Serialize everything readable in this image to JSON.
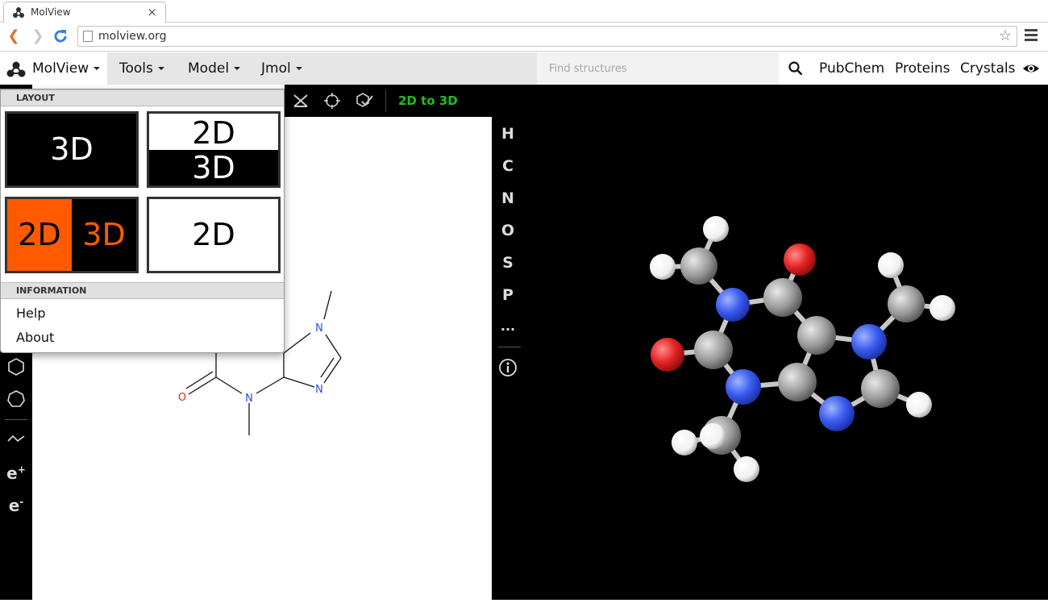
{
  "browser": {
    "tab_title": "MolView",
    "tab_close": "×",
    "url": "molview.org"
  },
  "header": {
    "brand": "MolView",
    "menus": [
      "Tools",
      "Model",
      "Jmol"
    ],
    "search_placeholder": "Find structures",
    "links": [
      "PubChem",
      "Proteins",
      "Crystals"
    ]
  },
  "sketcher": {
    "convert_label": "2D to 3D",
    "left_tools": {
      "e_plus": "e",
      "e_plus_sup": "+",
      "e_minus": "e",
      "e_minus_sup": "-"
    },
    "atom_labels": [
      "N",
      "N",
      "N",
      "O"
    ]
  },
  "elements": [
    "H",
    "C",
    "N",
    "O",
    "S",
    "P",
    "..."
  ],
  "dropdown": {
    "layout_header": "LAYOUT",
    "layouts": [
      {
        "name": "3D",
        "active": false
      },
      {
        "top": "2D",
        "bottom": "3D",
        "active": false
      },
      {
        "left": "2D",
        "right": "3D",
        "active": true
      },
      {
        "name": "2D",
        "active": false
      }
    ],
    "info_header": "INFORMATION",
    "info_items": [
      "Help",
      "About"
    ]
  },
  "colors": {
    "accent": "#ff5a00",
    "to3d_green": "#1fbf1f",
    "oxygen": "#e52323",
    "nitrogen": "#3a5bef",
    "carbon": "#9a9a9a",
    "hydrogen": "#ffffff"
  }
}
